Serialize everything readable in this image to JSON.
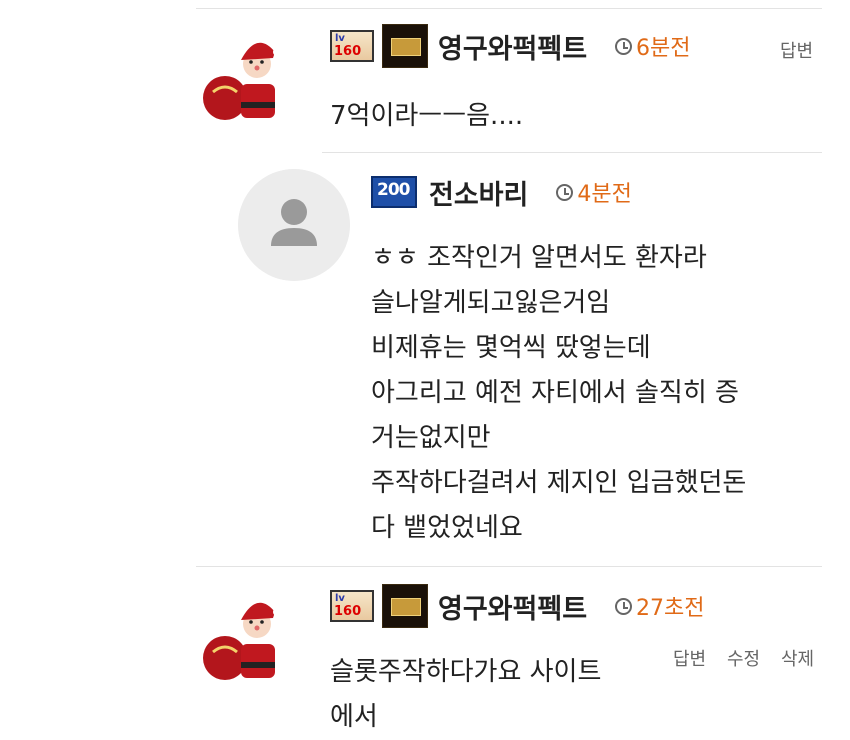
{
  "comments": [
    {
      "author": "영구와퍽펙트",
      "level_badge": "lv160",
      "time": "6분전",
      "actions": [
        "답변"
      ],
      "lines": [
        "7억이라ㅡㅡ음...."
      ]
    },
    {
      "author": "전소바리",
      "level_badge": "200",
      "time": "4분전",
      "actions": [],
      "lines": [
        "ㅎㅎ 조작인거 알면서도 환자라",
        "슬나알게되고잃은거임",
        "비제휴는 몇억씩 땄엏는데",
        "아그리고 예전 자티에서 솔직히 증",
        "거는없지만",
        "주작하다걸려서 제지인 입금했던돈",
        "다 뱉었었네요"
      ]
    },
    {
      "author": "영구와퍽펙트",
      "level_badge": "lv160",
      "time": "27초전",
      "actions": [
        "답변",
        "수정",
        "삭제"
      ],
      "lines": [
        "슬롯주작하다가요 사이트",
        "에서"
      ]
    }
  ],
  "icons": {
    "clock": "clock-icon",
    "default_avatar": "person-icon"
  },
  "colors": {
    "time": "#e06a17",
    "divider": "#e3e3e3",
    "level200": "#1e4fa8"
  }
}
